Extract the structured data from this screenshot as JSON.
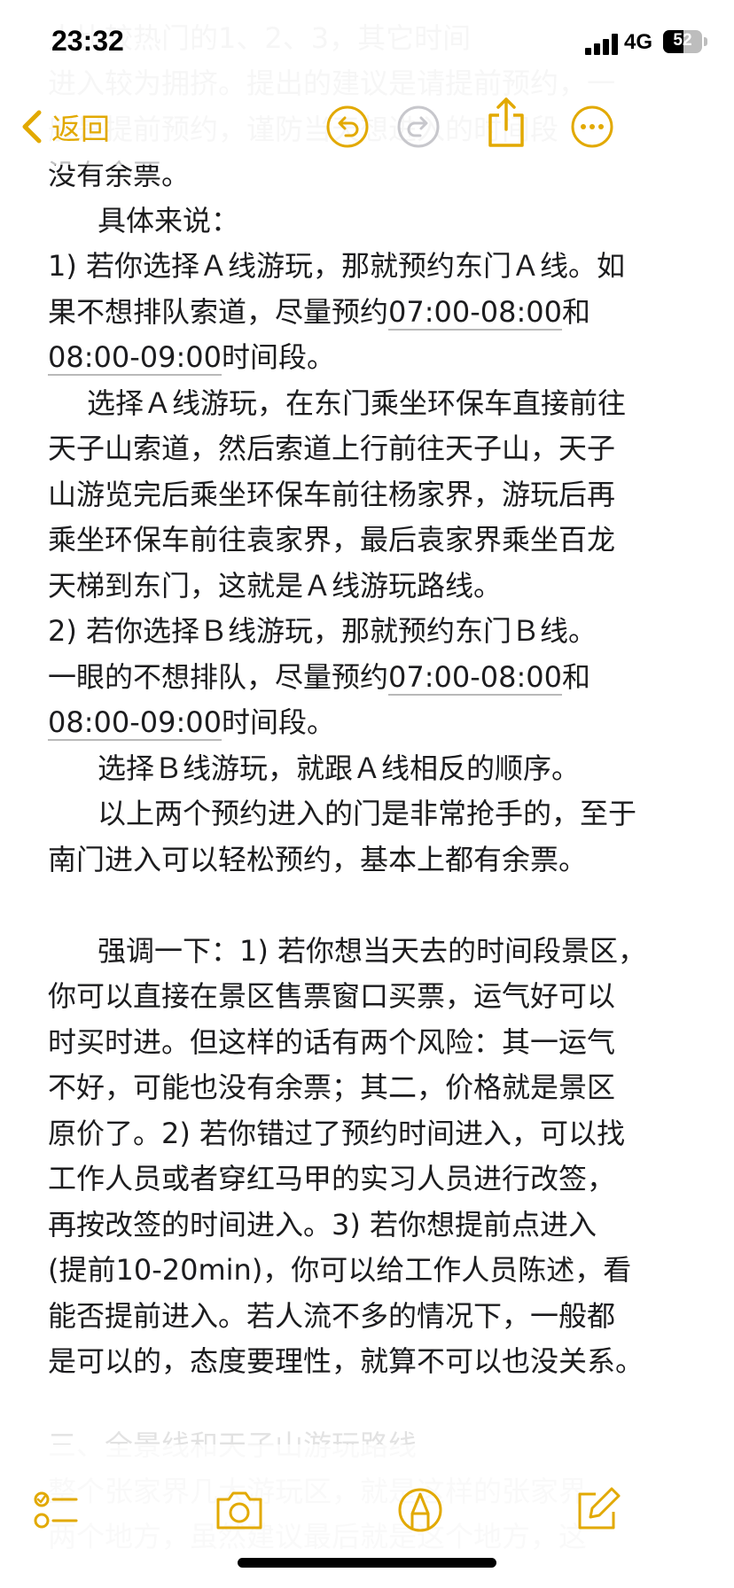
{
  "status_bar": {
    "time": "23:32",
    "network": "4G",
    "battery_level": "52",
    "battery_fraction": 0.52
  },
  "nav": {
    "back_label": "返回",
    "accent_color": "#e2a900"
  },
  "icons": {
    "undo": "undo-icon",
    "redo": "redo-icon",
    "share": "share-icon",
    "more": "more-icon",
    "checklist": "checklist-icon",
    "camera": "camera-icon",
    "markup": "markup-pen-icon",
    "compose": "compose-icon"
  },
  "note": {
    "top_faded_lines": [
      "",
      "     人比较热门的1、2、3，其它时间",
      "进入较为拥挤。提出的建议是请提前预约，一",
      "般是提前预约，谨防当天想进入的时间段"
    ],
    "lines": [
      {
        "parts": [
          "没有余票。"
        ]
      },
      {
        "indent": "ind",
        "parts": [
          "具体来说："
        ]
      },
      {
        "parts": [
          "1) 若你选择Ａ线游玩，那就预约东门Ａ线。如"
        ]
      },
      {
        "parts": [
          "果不想排队索道，尽量预约",
          {
            "u": "07:00-08:00"
          },
          "和"
        ]
      },
      {
        "parts": [
          {
            "u": "08:00-09:00"
          },
          "时间段。"
        ]
      },
      {
        "indent": "ind-s",
        "parts": [
          "选择Ａ线游玩，在东门乘坐环保车直接前往"
        ]
      },
      {
        "parts": [
          "天子山索道，然后索道上行前往天子山，天子"
        ]
      },
      {
        "parts": [
          "山游览完后乘坐环保车前往杨家界，游玩后再"
        ]
      },
      {
        "parts": [
          "乘坐环保车前往袁家界，最后袁家界乘坐百龙"
        ]
      },
      {
        "parts": [
          "天梯到东门，这就是Ａ线游玩路线。"
        ]
      },
      {
        "parts": [
          "2) 若你选择Ｂ线游玩，那就预约东门Ｂ线。"
        ]
      },
      {
        "parts": [
          "一眼的不想排队，尽量预约",
          {
            "u": "07:00-08:00"
          },
          "和"
        ]
      },
      {
        "parts": [
          {
            "u": "08:00-09:00"
          },
          "时间段。"
        ]
      },
      {
        "indent": "ind",
        "parts": [
          "选择Ｂ线游玩，就跟Ａ线相反的顺序。"
        ]
      },
      {
        "indent": "ind",
        "parts": [
          "以上两个预约进入的门是非常抢手的，至于"
        ]
      },
      {
        "parts": [
          "南门进入可以轻松预约，基本上都有余票。"
        ]
      },
      {
        "blank": true
      },
      {
        "indent": "ind",
        "parts": [
          "强调一下：1) 若你想当天去的时间段景区，"
        ]
      },
      {
        "parts": [
          "你可以直接在景区售票窗口买票，运气好可以"
        ]
      },
      {
        "parts": [
          "时买时进。但这样的话有两个风险：其一运气"
        ]
      },
      {
        "parts": [
          "不好，可能也没有余票；其二，价格就是景区"
        ]
      },
      {
        "parts": [
          "原价了。2) 若你错过了预约时间进入，可以找"
        ]
      },
      {
        "parts": [
          "工作人员或者穿红马甲的实习人员进行改签，"
        ]
      },
      {
        "parts": [
          "再按改签的时间进入。3) 若你想提前点进入"
        ]
      },
      {
        "parts": [
          "(提前10-20min)，你可以给工作人员陈述，看"
        ]
      },
      {
        "parts": [
          "能否提前进入。若人流不多的情况下，一般都"
        ]
      },
      {
        "parts": [
          "是可以的，态度要理性，就算不可以也没关系。"
        ]
      }
    ],
    "bottom_faded_lines": [
      "三、全景线和天子山游玩路线",
      "     整个张家界几大游玩区，就是这样的张家界",
      "两个地方，虽然建议最后就是这个地方，这"
    ]
  }
}
